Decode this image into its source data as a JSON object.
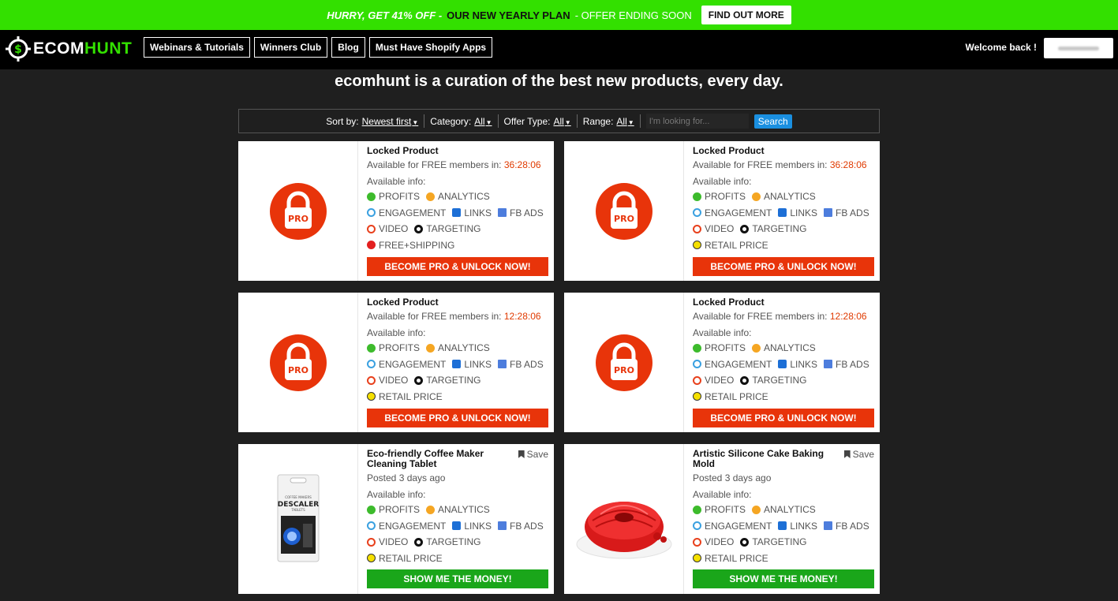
{
  "promo": {
    "hurry": "HURRY, GET 41% OFF -",
    "plan": "OUR NEW YEARLY PLAN",
    "ending": "- OFFER ENDING SOON",
    "cta": "FIND OUT MORE"
  },
  "header": {
    "logo_part1": "ECOM",
    "logo_part2": "HUNT",
    "nav": [
      "Webinars & Tutorials",
      "Winners Club",
      "Blog",
      "Must Have Shopify Apps"
    ],
    "welcome": "Welcome back !"
  },
  "tagline": "ecomhunt is a curation of the best new products, every day.",
  "filters": {
    "sort_label": "Sort by:",
    "sort_value": "Newest first",
    "category_label": "Category:",
    "category_value": "All",
    "offer_label": "Offer Type:",
    "offer_value": "All",
    "range_label": "Range:",
    "range_value": "All",
    "search_placeholder": "I'm looking for...",
    "search_button": "Search"
  },
  "labels": {
    "available_info": "Available info:",
    "profits": "PROFITS",
    "analytics": "ANALYTICS",
    "engagement": "ENGAGEMENT",
    "links": "LINKS",
    "fb_ads": "FB ADS",
    "video": "VIDEO",
    "targeting": "TARGETING",
    "retail_price": "RETAIL PRICE",
    "free_shipping": "FREE+SHIPPING",
    "save": "Save",
    "pro_badge": "PRO"
  },
  "cards": [
    {
      "title": "Locked Product",
      "available_prefix": "Available for FREE members in:",
      "timer": "36:28:06",
      "extra": "FREE+SHIPPING",
      "button": "BECOME PRO & UNLOCK NOW!"
    },
    {
      "title": "Locked Product",
      "available_prefix": "Available for FREE members in:",
      "timer": "36:28:06",
      "extra": "RETAIL PRICE",
      "button": "BECOME PRO & UNLOCK NOW!"
    },
    {
      "title": "Locked Product",
      "available_prefix": "Available for FREE members in:",
      "timer": "12:28:06",
      "extra": "RETAIL PRICE",
      "button": "BECOME PRO & UNLOCK NOW!"
    },
    {
      "title": "Locked Product",
      "available_prefix": "Available for FREE members in:",
      "timer": "12:28:06",
      "extra": "RETAIL PRICE",
      "button": "BECOME PRO & UNLOCK NOW!"
    },
    {
      "title": "Eco-friendly Coffee Maker Cleaning Tablet",
      "posted": "Posted 3 days ago",
      "extra": "RETAIL PRICE",
      "button": "SHOW ME THE MONEY!"
    },
    {
      "title": "Artistic Silicone Cake Baking Mold",
      "posted": "Posted 3 days ago",
      "extra": "RETAIL PRICE",
      "button": "SHOW ME THE MONEY!"
    }
  ],
  "product_images": {
    "descaler_label": "DESCALER",
    "descaler_small_top": "COFFEE MAKERS",
    "descaler_small_bottom": "TABLETS"
  },
  "colors": {
    "promo_bg": "#33e000",
    "accent_red": "#e8340a",
    "accent_green": "#1aa61a",
    "search_blue": "#1a8fe0",
    "timer_red": "#e03a00"
  }
}
